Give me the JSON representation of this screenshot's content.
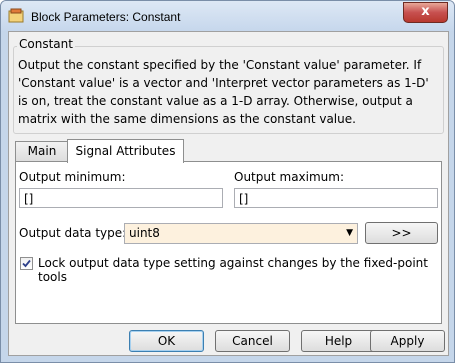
{
  "window": {
    "title": "Block Parameters: Constant",
    "close_glyph": "x"
  },
  "group": {
    "title": "Constant",
    "description": "Output the constant specified by the 'Constant value' parameter. If 'Constant value' is a vector and 'Interpret vector parameters as 1-D' is on, treat the constant value as a 1-D array. Otherwise, output a matrix with the same dimensions as the constant value."
  },
  "tabs": [
    {
      "label": "Main",
      "active": false
    },
    {
      "label": "Signal Attributes",
      "active": true
    }
  ],
  "signal": {
    "min_label": "Output minimum:",
    "min_value": "[]",
    "max_label": "Output maximum:",
    "max_value": "[]",
    "type_label": "Output data type:",
    "type_value": "uint8",
    "assistant_label": ">>",
    "lock_label": "Lock output data type setting against changes by the fixed-point tools",
    "lock_checked": true
  },
  "buttons": {
    "ok": "OK",
    "cancel": "Cancel",
    "help": "Help",
    "apply": "Apply"
  },
  "icons": {
    "app": "simulink-block-icon",
    "close": "close-icon",
    "dropdown": "chevron-down-icon",
    "check": "checkmark-icon"
  }
}
